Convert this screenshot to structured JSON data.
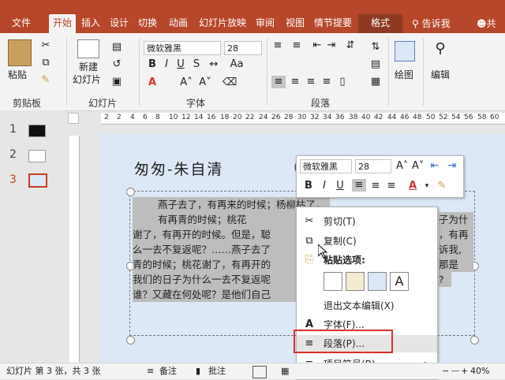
{
  "tabs": [
    "文件",
    "开始",
    "插入",
    "设计",
    "切换",
    "动画",
    "幻灯片放映",
    "审阅",
    "视图",
    "情节提要",
    "格式"
  ],
  "tell_me": "告诉我",
  "share": "共享",
  "ribbon": {
    "clipboard": {
      "paste": "粘贴",
      "group": "剪贴板"
    },
    "slides": {
      "new_slide_1": "新建",
      "new_slide_2": "幻灯片",
      "group": "幻灯片"
    },
    "font": {
      "name": "微软雅黑",
      "size": "28",
      "group": "字体"
    },
    "paragraph": {
      "group": "段落"
    },
    "drawing": {
      "label": "绘图"
    },
    "editing": {
      "label": "编辑"
    }
  },
  "slides": [
    {
      "num": "1"
    },
    {
      "num": "2"
    },
    {
      "num": "3",
      "selected": true
    }
  ],
  "ruler_numbers": [
    "2",
    "2",
    "4",
    "6",
    "8",
    "10",
    "12",
    "14",
    "16",
    "18",
    "20",
    "22",
    "24",
    "26",
    "28",
    "30",
    "32",
    "34",
    "36",
    "38",
    "40",
    "42",
    "44",
    "46",
    "48",
    "50",
    "52",
    "54",
    "56",
    "58",
    "60"
  ],
  "slide": {
    "title": "匆匆-朱自清",
    "title_tail": "(",
    "body_lines": [
      "燕子去了，有再来的时候；杨柳枯了，有再青的时候；桃花",
      "谢了，有再开的时候。但是，聪",
      "么一去不复返呢？……燕子去了",
      "青的时候；桃花谢了，有再开的",
      "我们的日子为什么一去不复返呢",
      "谁？又藏在何处呢？是他们自己"
    ],
    "body_right": [
      "子为什",
      "，有再",
      "诉我,",
      "那是",
      "?"
    ]
  },
  "minibar": {
    "font": "微软雅黑",
    "size": "28",
    "bold": "B",
    "italic": "I",
    "underline": "U"
  },
  "context_menu": {
    "cut": "剪切(T)",
    "copy": "复制(C)",
    "paste_options": "粘贴选项:",
    "exit_edit": "退出文本编辑(X)",
    "font": "字体(F)...",
    "paragraph": "段落(P)...",
    "bullets": "项目符号(B)"
  },
  "status": {
    "slide_info": "幻灯片 第 3 张，共 3 张",
    "notes": "备注",
    "comments": "批注",
    "zoom": "40%"
  },
  "colors": {
    "accent": "#b7472a",
    "highlight": "#d9312c"
  }
}
